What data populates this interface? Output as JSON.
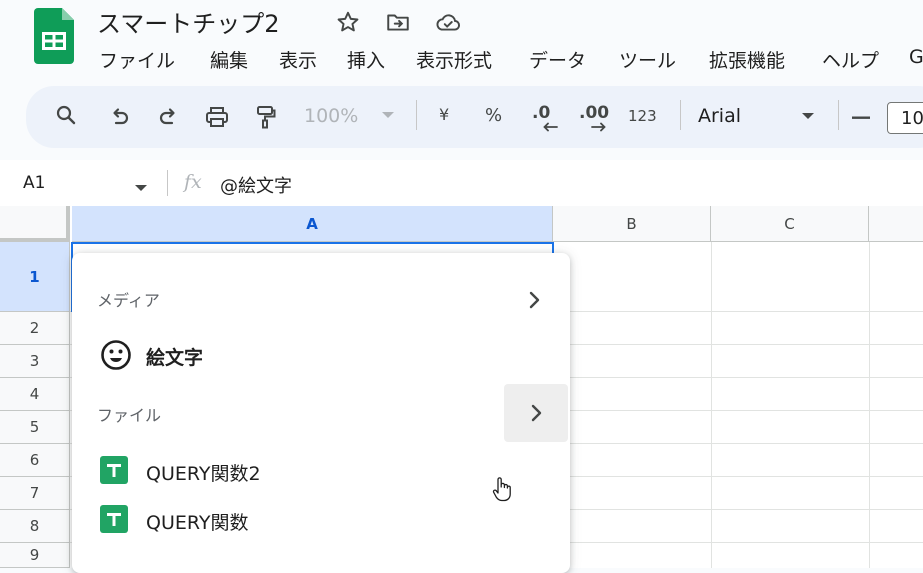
{
  "app": {
    "doc_title": "スマートチップ2",
    "brand_color": "#0f9d58"
  },
  "menubar": {
    "items": [
      "ファイル",
      "編集",
      "表示",
      "挿入",
      "表示形式",
      "データ",
      "ツール",
      "拡張機能",
      "ヘルプ",
      "G"
    ]
  },
  "toolbar": {
    "zoom": "100%",
    "currency": "¥",
    "percent": "%",
    "dec_decrease": ".0",
    "dec_increase": ".00",
    "number_format": "123",
    "font": "Arial",
    "font_size": "10"
  },
  "formula_bar": {
    "cell_ref": "A1",
    "fx": "fx",
    "content": "@絵文字"
  },
  "grid": {
    "columns": [
      "A",
      "B",
      "C"
    ],
    "rows": [
      "1",
      "2",
      "3",
      "4",
      "5",
      "6",
      "7",
      "8",
      "9"
    ],
    "selected_cell": "A1"
  },
  "popup": {
    "section_media": "メディア",
    "emoji_label": "絵文字",
    "section_file": "ファイル",
    "files": [
      "QUERY関数2",
      "QUERY関数"
    ]
  }
}
